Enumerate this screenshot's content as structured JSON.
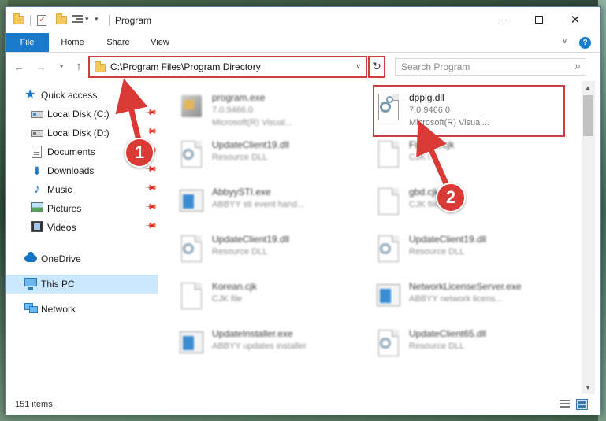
{
  "window": {
    "title": "Program",
    "controls": {
      "minimize": "Minimize",
      "maximize": "Maximize",
      "close": "Close"
    }
  },
  "ribbon": {
    "tabs": [
      {
        "label": "File"
      },
      {
        "label": "Home"
      },
      {
        "label": "Share"
      },
      {
        "label": "View"
      }
    ],
    "help": "?"
  },
  "address": {
    "path": "C:\\Program Files\\Program Directory"
  },
  "search": {
    "placeholder": "Search Program"
  },
  "sidebar": {
    "items": [
      {
        "label": "Quick access",
        "icon": "star-icon",
        "pinned": false
      },
      {
        "label": "Local Disk (C:)",
        "icon": "drive-c-icon",
        "pinned": true
      },
      {
        "label": "Local Disk (D:)",
        "icon": "drive-d-icon",
        "pinned": true
      },
      {
        "label": "Documents",
        "icon": "documents-icon",
        "pinned": true
      },
      {
        "label": "Downloads",
        "icon": "downloads-icon",
        "pinned": true
      },
      {
        "label": "Music",
        "icon": "music-icon",
        "pinned": true
      },
      {
        "label": "Pictures",
        "icon": "pictures-icon",
        "pinned": true
      },
      {
        "label": "Videos",
        "icon": "videos-icon",
        "pinned": true
      },
      {
        "label": "OneDrive",
        "icon": "onedrive-icon",
        "pinned": false
      },
      {
        "label": "This PC",
        "icon": "this-pc-icon",
        "pinned": false,
        "selected": true
      },
      {
        "label": "Network",
        "icon": "network-icon",
        "pinned": false
      }
    ]
  },
  "files": [
    {
      "name": "program.exe",
      "type": "7.0.9466.0",
      "desc": "Microsoft(R) Visual...",
      "icon": "exe-icon",
      "blurred": true
    },
    {
      "name": "dpplg.dll",
      "type": "7.0.9466.0",
      "desc": "Microsoft(R) Visual...",
      "icon": "dll-gear-icon",
      "blurred": false
    },
    {
      "name": "UpdateClient19.dll",
      "type": "Resource DLL",
      "desc": "",
      "icon": "dll-icon",
      "blurred": true
    },
    {
      "name": "Finntml.cjk",
      "type": "CJK file",
      "desc": "",
      "icon": "file-icon",
      "blurred": true
    },
    {
      "name": "AbbyySTI.exe",
      "type": "ABBYY sti event hand...",
      "desc": "",
      "icon": "app-icon",
      "blurred": true
    },
    {
      "name": "gbd.cjk",
      "type": "CJK file",
      "desc": "",
      "icon": "file-icon",
      "blurred": true
    },
    {
      "name": "UpdateClient19.dll",
      "type": "Resource DLL",
      "desc": "",
      "icon": "dll-icon",
      "blurred": true
    },
    {
      "name": "UpdateClient19.dll",
      "type": "Resource DLL",
      "desc": "",
      "icon": "dll-icon",
      "blurred": true
    },
    {
      "name": "Korean.cjk",
      "type": "CJK file",
      "desc": "",
      "icon": "file-icon",
      "blurred": true
    },
    {
      "name": "NetworkLicenseServer.exe",
      "type": "ABBYY network licens...",
      "desc": "",
      "icon": "app-icon",
      "blurred": true
    },
    {
      "name": "UpdateInstaller.exe",
      "type": "ABBYY updates installer",
      "desc": "",
      "icon": "app-icon",
      "blurred": true
    },
    {
      "name": "UpdateClient65.dll",
      "type": "Resource DLL",
      "desc": "",
      "icon": "dll-icon",
      "blurred": true
    }
  ],
  "status": {
    "item_count": "151 items"
  },
  "annotations": {
    "badge1": "1",
    "badge2": "2",
    "accent": "#d93a35"
  },
  "colors": {
    "accent_blue": "#1979ca",
    "selected_bg": "#cce8ff",
    "highlight_red": "#cf3e3e"
  }
}
